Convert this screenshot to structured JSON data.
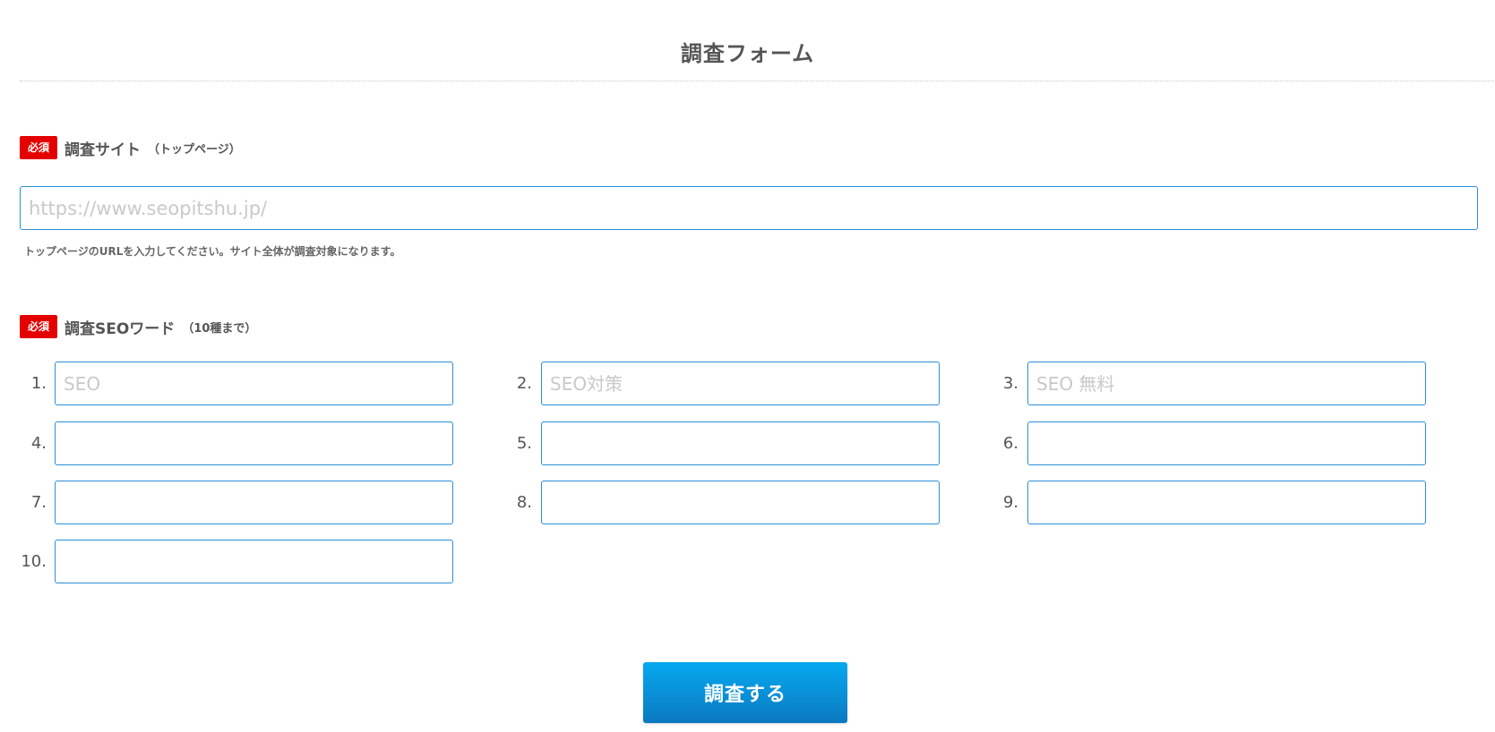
{
  "page": {
    "title": "調査フォーム"
  },
  "site_section": {
    "required_badge": "必須",
    "label": "調査サイト",
    "note": "（トップページ）",
    "input_placeholder": "https://www.seopitshu.jp/",
    "input_value": "",
    "help_text": "トップページのURLを入力してください。サイト全体が調査対象になります。"
  },
  "keywords_section": {
    "required_badge": "必須",
    "label": "調査SEOワード",
    "note": "（10種まで）",
    "fields": [
      {
        "number": "1.",
        "placeholder": "SEO",
        "value": ""
      },
      {
        "number": "2.",
        "placeholder": "SEO対策",
        "value": ""
      },
      {
        "number": "3.",
        "placeholder": "SEO 無料",
        "value": ""
      },
      {
        "number": "4.",
        "placeholder": "",
        "value": ""
      },
      {
        "number": "5.",
        "placeholder": "",
        "value": ""
      },
      {
        "number": "6.",
        "placeholder": "",
        "value": ""
      },
      {
        "number": "7.",
        "placeholder": "",
        "value": ""
      },
      {
        "number": "8.",
        "placeholder": "",
        "value": ""
      },
      {
        "number": "9.",
        "placeholder": "",
        "value": ""
      },
      {
        "number": "10.",
        "placeholder": "",
        "value": ""
      }
    ]
  },
  "submit": {
    "label": "調査する"
  },
  "colors": {
    "required_badge": "#e50000",
    "input_border": "#2a8fd8",
    "button_top": "#04a8ef",
    "button_bottom": "#0b78bf",
    "text": "#555555",
    "placeholder": "#c9c9c9"
  }
}
